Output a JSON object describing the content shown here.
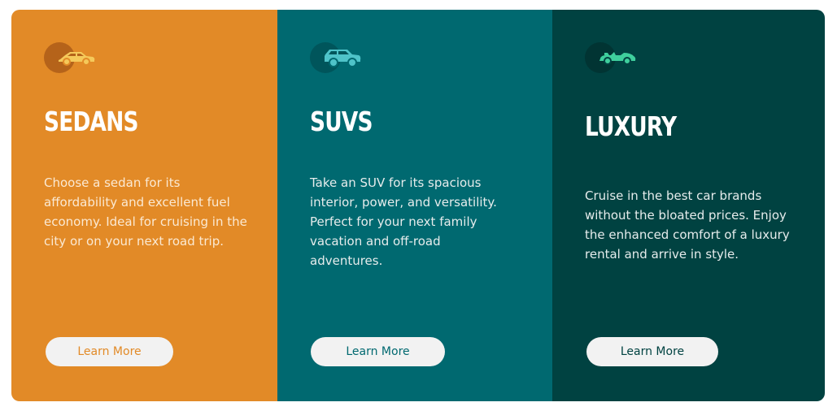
{
  "cards": [
    {
      "title": "SEDANS",
      "description": "Choose a sedan for its affordability and excellent fuel economy. Ideal for cruising in the city or on your next road trip.",
      "button_label": "Learn More",
      "icon": "sedan-car-icon",
      "background": "#e28a27"
    },
    {
      "title": "SUVS",
      "description": "Take an SUV for its spacious interior, power, and versatility. Perfect for your next family vacation and off-road adventures.",
      "button_label": "Learn More",
      "icon": "suv-car-icon",
      "background": "#006970"
    },
    {
      "title": "LUXURY",
      "description": "Cruise in the best car brands without the bloated prices. Enjoy the enhanced comfort of a luxury rental and arrive in style.",
      "button_label": "Learn More",
      "icon": "luxury-car-icon",
      "background": "#004241"
    }
  ],
  "colors": {
    "sedans": "#e28a27",
    "suvs": "#006970",
    "luxury": "#004241",
    "button_bg": "#f2f2f2"
  }
}
